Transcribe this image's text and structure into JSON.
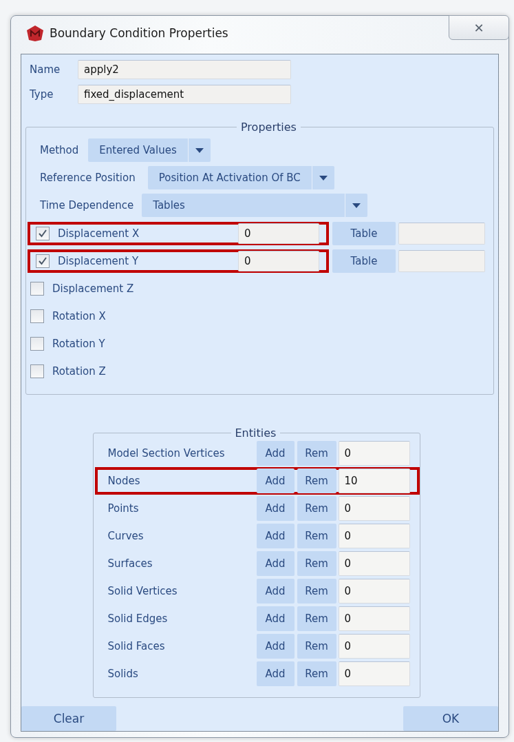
{
  "window": {
    "title": "Boundary Condition Properties",
    "close": "✕"
  },
  "fields": [
    {
      "label": "Name",
      "value": "apply2"
    },
    {
      "label": "Type",
      "value": "fixed_displacement"
    }
  ],
  "properties": {
    "title": "Properties",
    "dropdowns": [
      {
        "label": "Method",
        "value": "Entered Values"
      },
      {
        "label": "Reference Position",
        "value": "Position At Activation Of BC"
      },
      {
        "label": "Time Dependence",
        "value": "Tables"
      }
    ],
    "components": [
      {
        "label": "Displacement X",
        "checked": true,
        "value": "0",
        "table_button": "Table",
        "highlighted": true
      },
      {
        "label": "Displacement Y",
        "checked": true,
        "value": "0",
        "table_button": "Table",
        "highlighted": true
      },
      {
        "label": "Displacement Z",
        "checked": false
      },
      {
        "label": "Rotation X",
        "checked": false
      },
      {
        "label": "Rotation Y",
        "checked": false
      },
      {
        "label": "Rotation Z",
        "checked": false
      }
    ]
  },
  "entities": {
    "title": "Entities",
    "rows": [
      {
        "label": "Model Section Vertices",
        "add": "Add",
        "remove": "Rem",
        "count": "0"
      },
      {
        "label": "Nodes",
        "add": "Add",
        "remove": "Rem",
        "count": "10",
        "highlighted": true
      },
      {
        "label": "Points",
        "add": "Add",
        "remove": "Rem",
        "count": "0"
      },
      {
        "label": "Curves",
        "add": "Add",
        "remove": "Rem",
        "count": "0"
      },
      {
        "label": "Surfaces",
        "add": "Add",
        "remove": "Rem",
        "count": "0"
      },
      {
        "label": "Solid Vertices",
        "add": "Add",
        "remove": "Rem",
        "count": "0"
      },
      {
        "label": "Solid Edges",
        "add": "Add",
        "remove": "Rem",
        "count": "0"
      },
      {
        "label": "Solid Faces",
        "add": "Add",
        "remove": "Rem",
        "count": "0"
      },
      {
        "label": "Solids",
        "add": "Add",
        "remove": "Rem",
        "count": "0"
      }
    ]
  },
  "buttons": [
    {
      "label": "Clear"
    },
    {
      "label": "OK"
    }
  ]
}
